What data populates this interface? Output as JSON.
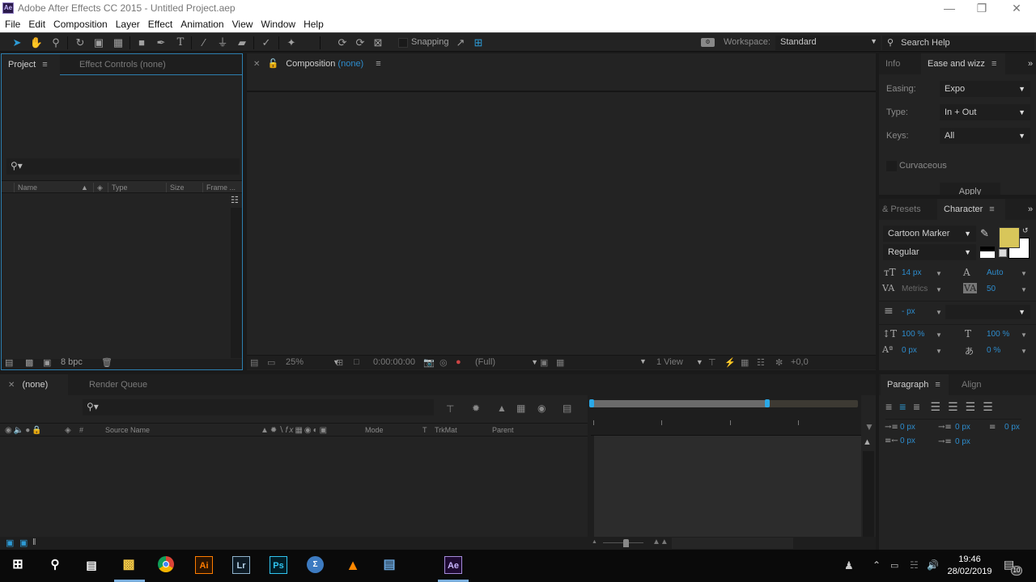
{
  "window": {
    "title": "Adobe After Effects CC 2015 - Untitled Project.aep",
    "app_icon": "Ae",
    "controls": [
      "minimize-icon",
      "restore-icon",
      "close-icon"
    ]
  },
  "menu": [
    "File",
    "Edit",
    "Composition",
    "Layer",
    "Effect",
    "Animation",
    "View",
    "Window",
    "Help"
  ],
  "toolbar": {
    "tools": [
      "selection-tool",
      "hand-tool",
      "zoom-tool",
      "rotation-tool",
      "camera-tool",
      "pan-behind-tool",
      "rectangle-tool",
      "pen-tool",
      "type-tool",
      "brush-tool",
      "clone-stamp-tool",
      "eraser-tool",
      "roto-brush-tool",
      "puppet-pin-tool",
      "local-axis-mode",
      "world-axis-mode",
      "view-axis-mode"
    ],
    "snapping_label": "Snapping",
    "workspace_label": "Workspace:",
    "workspace_value": "Standard",
    "search_help": "Search Help"
  },
  "project_panel": {
    "tab_active": "Project",
    "tab_inactive": "Effect Controls (none)",
    "columns": [
      "Name",
      "Type",
      "Size",
      "Frame ..."
    ],
    "bpc": "8 bpc"
  },
  "composition_panel": {
    "tab_label": "Composition",
    "tab_value": "(none)",
    "zoom": "25%",
    "timecode": "0:00:00:00",
    "resolution": "(Full)",
    "views": "1 View",
    "exposure": "+0,0"
  },
  "ease_panel": {
    "tab_info": "Info",
    "tab_active": "Ease and wizz",
    "easing_label": "Easing:",
    "easing_value": "Expo",
    "type_label": "Type:",
    "type_value": "In + Out",
    "keys_label": "Keys:",
    "keys_value": "All",
    "curvaceous_label": "Curvaceous",
    "curvaceous_checked": false,
    "apply_label": "Apply"
  },
  "character_panel": {
    "tab_presets": "& Presets",
    "tab_active": "Character",
    "font_family": "Cartoon Marker",
    "font_style": "Regular",
    "fill_color": "#d8c65a",
    "font_size": "14 px",
    "leading": "Auto",
    "kerning": "Metrics",
    "tracking": "50",
    "stroke_width": "- px",
    "vertical_scale": "100 %",
    "horizontal_scale": "100 %",
    "baseline_shift": "0 px",
    "tsume": "0 %"
  },
  "paragraph_panel": {
    "tab_active": "Paragraph",
    "tab_align": "Align",
    "indent_left": "0 px",
    "indent_first": "0 px",
    "space_before": "0 px",
    "indent_right": "0 px",
    "space_after": "0 px",
    "selected_alignment": "center"
  },
  "timeline_panel": {
    "tab_comp": "(none)",
    "tab_render": "Render Queue",
    "columns": {
      "number": "#",
      "source_name": "Source Name",
      "mode": "Mode",
      "t": "T",
      "trkmat": "TrkMat",
      "parent": "Parent"
    },
    "work_area_fraction": 0.66
  },
  "taskbar": {
    "apps": [
      "windows-start",
      "search",
      "task-view",
      "file-explorer",
      "chrome",
      "Ai",
      "Lr",
      "Ps",
      "sigma-app",
      "vlc",
      "network-app",
      "Ae"
    ],
    "time": "19:46",
    "date": "28/02/2019",
    "notifications": "10"
  },
  "colors": {
    "accent": "#2d8ccd",
    "panel_bg": "#232323",
    "focus_border": "#2d7fb0"
  }
}
